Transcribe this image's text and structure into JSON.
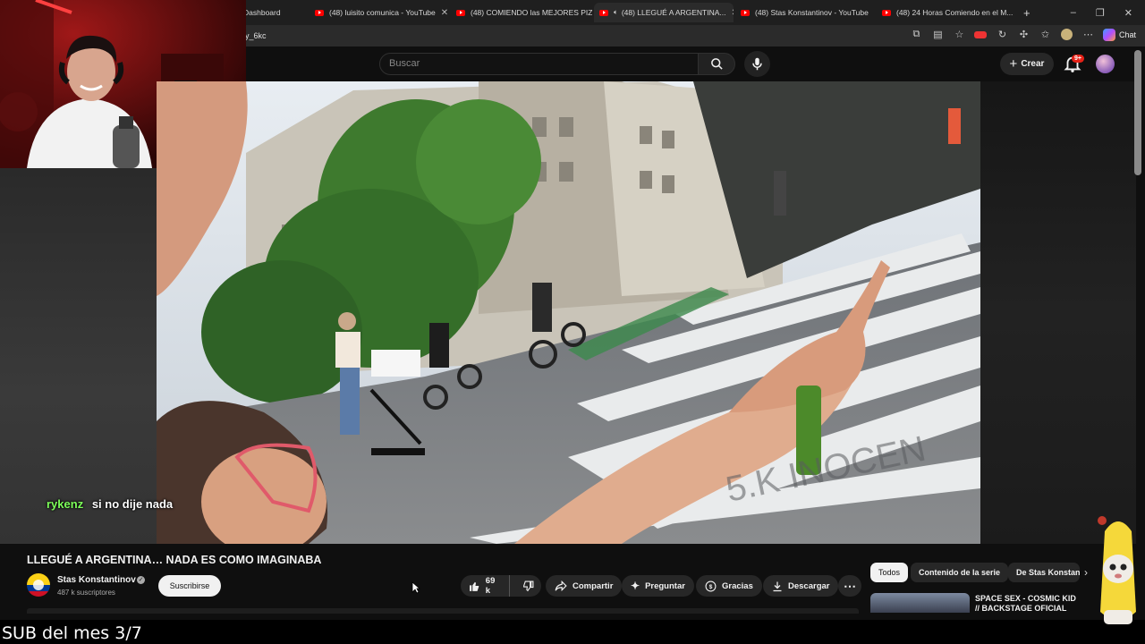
{
  "browser": {
    "tabs": [
      {
        "label": "Dashboard",
        "favicon": false,
        "active": false
      },
      {
        "label": "(48) luisito comunica - YouTube",
        "favicon": true,
        "active": false
      },
      {
        "label": "(48) COMIENDO las MEJORES PIZ...",
        "favicon": true,
        "active": false
      },
      {
        "label": "(48) LLEGUÉ A ARGENTINA...",
        "favicon": true,
        "active": true,
        "audio": true
      },
      {
        "label": "(48) Stas Konstantinov - YouTube",
        "favicon": true,
        "active": false
      },
      {
        "label": "(48) 24 Horas Comiendo en el M...",
        "favicon": true,
        "active": false
      }
    ],
    "url_fragment": "y_6kc",
    "chat_label": "Chat"
  },
  "header": {
    "search_placeholder": "Buscar",
    "create_label": "Crear",
    "notif_badge": "9+"
  },
  "chat_overlay": {
    "user": "rykenz",
    "message": "si no dije nada",
    "user_color": "#7dff5a"
  },
  "video": {
    "title": "LLEGUÉ A ARGENTINA… NADA ES COMO IMAGINABA",
    "channel_name": "Stas Konstantinov",
    "subscribers": "487 k suscriptores",
    "subscribe_label": "Suscribirse",
    "likes": "69 k",
    "share_label": "Compartir",
    "ask_label": "Preguntar",
    "thanks_label": "Gracias",
    "download_label": "Descargar"
  },
  "sidebar": {
    "chips": [
      "Todos",
      "Contenido de la serie",
      "De Stas Konstantinov"
    ],
    "recommendation_title": "SPACE SEX - COSMIC KID // BACKSTAGE OFICIAL"
  },
  "stream": {
    "sub_goal": "SUB del mes 3/7"
  },
  "colors": {
    "yt_red": "#ff0000",
    "background": "#0f0f0f",
    "pill": "#272727"
  }
}
